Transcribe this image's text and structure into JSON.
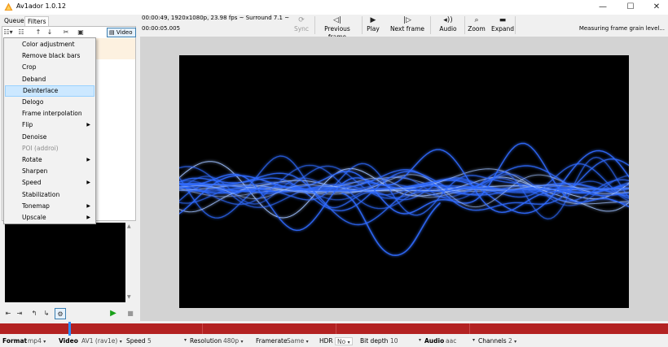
{
  "window": {
    "title": "Av1ador 1.0.12",
    "minimize": "—",
    "maximize": "☐",
    "close": "✕"
  },
  "left_tabs": [
    "Queue",
    "Filters"
  ],
  "left_toolbar": {
    "video_button": "Video"
  },
  "filter_menu": [
    {
      "label": "Color adjustment",
      "submenu": false,
      "disabled": false,
      "highlighted": false
    },
    {
      "label": "Remove black bars",
      "submenu": false,
      "disabled": false,
      "highlighted": false
    },
    {
      "label": "Crop",
      "submenu": false,
      "disabled": false,
      "highlighted": false
    },
    {
      "label": "Deband",
      "submenu": false,
      "disabled": false,
      "highlighted": false
    },
    {
      "label": "Deinterlace",
      "submenu": false,
      "disabled": false,
      "highlighted": true
    },
    {
      "label": "Delogo",
      "submenu": false,
      "disabled": false,
      "highlighted": false
    },
    {
      "label": "Frame interpolation",
      "submenu": false,
      "disabled": false,
      "highlighted": false
    },
    {
      "label": "Flip",
      "submenu": true,
      "disabled": false,
      "highlighted": false
    },
    {
      "label": "Denoise",
      "submenu": false,
      "disabled": false,
      "highlighted": false
    },
    {
      "label": "POI (addroi)",
      "submenu": false,
      "disabled": true,
      "highlighted": false
    },
    {
      "label": "Rotate",
      "submenu": true,
      "disabled": false,
      "highlighted": false
    },
    {
      "label": "Sharpen",
      "submenu": false,
      "disabled": false,
      "highlighted": false
    },
    {
      "label": "Speed",
      "submenu": true,
      "disabled": false,
      "highlighted": false
    },
    {
      "label": "Stabilization",
      "submenu": false,
      "disabled": false,
      "highlighted": false
    },
    {
      "label": "Tonemap",
      "submenu": true,
      "disabled": false,
      "highlighted": false
    },
    {
      "label": "Upscale",
      "submenu": true,
      "disabled": false,
      "highlighted": false
    }
  ],
  "info": {
    "line1": "00:00:49, 1920x1080p, 23.98 fps ~ Surround 7.1 ~",
    "line2": "00:00:05.005",
    "measuring": "Measuring frame grain level..."
  },
  "player_tools": [
    {
      "label": "Sync",
      "icon": "sync-icon",
      "glyph": "⟳"
    },
    {
      "label": "Previous frame",
      "icon": "previous-frame-icon",
      "glyph": "◁|"
    },
    {
      "label": "Play",
      "icon": "play-icon",
      "glyph": "▶"
    },
    {
      "label": "Next frame",
      "icon": "next-frame-icon",
      "glyph": "|▷"
    },
    {
      "label": "Audio",
      "icon": "speaker-icon",
      "glyph": "◂))"
    },
    {
      "label": "Zoom",
      "icon": "magnifier-icon",
      "glyph": "⌕"
    },
    {
      "label": "Expand",
      "icon": "expand-icon",
      "glyph": "▬"
    }
  ],
  "statusbar": {
    "format_label": "Format",
    "format_value": "mp4",
    "video_label": "Video",
    "video_value": "AV1 (rav1e)",
    "speed_label": "Speed",
    "speed_value": "5",
    "resolution_label": "Resolution",
    "resolution_value": "480p",
    "framerate_label": "Framerate",
    "framerate_value": "Same",
    "hdr_label": "HDR",
    "hdr_value": "No",
    "bitdepth_label": "Bit depth",
    "bitdepth_value": "10",
    "audio_label": "Audio",
    "audio_value": "aac",
    "channels_label": "Channels",
    "channels_value": "2"
  },
  "colors": {
    "timeline": "#b32222",
    "timeline_marker": "#2a8cff",
    "menu_highlight": "#cce8ff",
    "waveform": "#2f6bff"
  }
}
